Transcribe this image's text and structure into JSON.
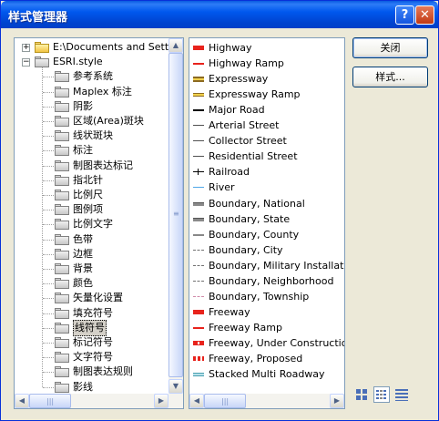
{
  "window": {
    "title": "样式管理器",
    "help_label": "?",
    "close_label": "✕"
  },
  "tree": {
    "root_label": "E:\\Documents and Settings",
    "style_label": "ESRI.style",
    "expander_root": "+",
    "expander_style": "−",
    "items": [
      {
        "label": "参考系统"
      },
      {
        "label": "Maplex 标注"
      },
      {
        "label": "阴影"
      },
      {
        "label": "区域(Area)斑块"
      },
      {
        "label": "线状斑块"
      },
      {
        "label": "标注"
      },
      {
        "label": "制图表达标记"
      },
      {
        "label": "指北针"
      },
      {
        "label": "比例尺"
      },
      {
        "label": "图例项"
      },
      {
        "label": "比例文字"
      },
      {
        "label": "色带"
      },
      {
        "label": "边框"
      },
      {
        "label": "背景"
      },
      {
        "label": "颜色"
      },
      {
        "label": "矢量化设置"
      },
      {
        "label": "填充符号"
      },
      {
        "label": "线符号",
        "selected": true
      },
      {
        "label": "标记符号"
      },
      {
        "label": "文字符号"
      },
      {
        "label": "制图表达规则"
      },
      {
        "label": "影线"
      }
    ]
  },
  "symbols": [
    {
      "label": "Highway",
      "style": "red-bar"
    },
    {
      "label": "Highway Ramp",
      "style": "red-thin"
    },
    {
      "label": "Expressway",
      "style": "brown-double"
    },
    {
      "label": "Expressway Ramp",
      "style": "brown-thin"
    },
    {
      "label": "Major Road",
      "style": "black-line"
    },
    {
      "label": "Arterial Street",
      "style": "gray-line"
    },
    {
      "label": "Collector Street",
      "style": "gray-line"
    },
    {
      "label": "Residential Street",
      "style": "gray-line"
    },
    {
      "label": "Railroad",
      "style": "railroad"
    },
    {
      "label": "River",
      "style": "blue-line"
    },
    {
      "label": "Boundary, National",
      "style": "gray-bar"
    },
    {
      "label": "Boundary, State",
      "style": "gray-bar"
    },
    {
      "label": "Boundary, County",
      "style": "gray-mid"
    },
    {
      "label": "Boundary, City",
      "style": "gray-dash"
    },
    {
      "label": "Boundary, Military Installation",
      "style": "gray-dash"
    },
    {
      "label": "Boundary, Neighborhood",
      "style": "gray-dash"
    },
    {
      "label": "Boundary, Township",
      "style": "pink-dash"
    },
    {
      "label": "Freeway",
      "style": "red-bar"
    },
    {
      "label": "Freeway Ramp",
      "style": "red-thin"
    },
    {
      "label": "Freeway, Under Construction",
      "style": "red-construct"
    },
    {
      "label": "Freeway, Proposed",
      "style": "red-proposed"
    },
    {
      "label": "Stacked Multi Roadway",
      "style": "teal-double"
    }
  ],
  "buttons": {
    "close": "关闭",
    "styles": "样式..."
  },
  "view_modes": [
    "large-icons",
    "list",
    "details"
  ],
  "active_view": "list"
}
